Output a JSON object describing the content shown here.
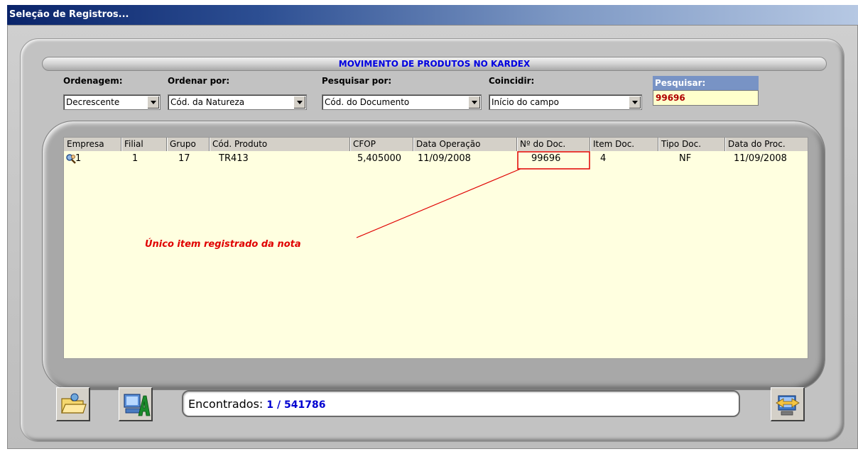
{
  "window": {
    "title": "Seleção de Registros..."
  },
  "header": {
    "title": "MOVIMENTO DE PRODUTOS NO KARDEX"
  },
  "filters": {
    "ordenagem": {
      "label": "Ordenagem:",
      "value": "Decrescente"
    },
    "ordenar_por": {
      "label": "Ordenar por:",
      "value": "Cód. da Natureza"
    },
    "pesquisar_por": {
      "label": "Pesquisar por:",
      "value": "Cód. do Documento"
    },
    "coincidir": {
      "label": "Coincidir:",
      "value": "Início do campo"
    },
    "pesquisar": {
      "label": "Pesquisar:",
      "value": "99696"
    }
  },
  "table": {
    "columns": [
      "Empresa",
      "Filial",
      "Grupo",
      "Cód. Produto",
      "CFOP",
      "Data Operação",
      "Nº do Doc.",
      "Item Doc.",
      "Tipo Doc.",
      "Data do Proc."
    ],
    "rows": [
      [
        "1",
        "1",
        "17",
        "TR413",
        "5,405000",
        "11/09/2008",
        "99696",
        "4",
        "NF",
        "11/09/2008"
      ]
    ]
  },
  "annotation": {
    "text": "Único item registrado da nota"
  },
  "status": {
    "label": "Encontrados:",
    "value": "1 / 541786"
  },
  "icons": {
    "row_indicator": "magnifier-person-icon",
    "open": "open-folder-icon",
    "report": "computer-a-icon",
    "exit": "swap-arrows-icon"
  },
  "colors": {
    "header_text": "#0000e0",
    "search_label_bg": "#7893c5",
    "search_value": "#b00000",
    "grid_bg": "#ffffe0",
    "highlight": "#e00000",
    "status_value": "#0000d0"
  }
}
